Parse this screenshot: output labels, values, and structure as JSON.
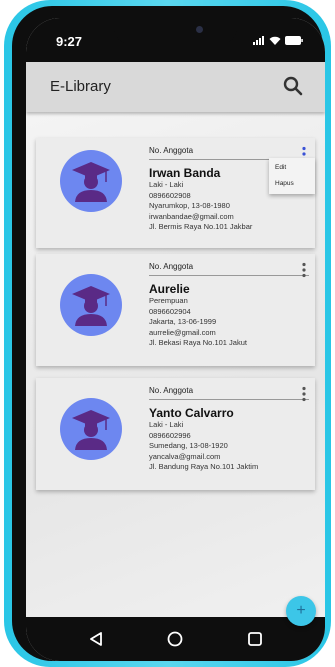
{
  "status": {
    "time": "9:27"
  },
  "appbar": {
    "title": "E-Library"
  },
  "members": [
    {
      "no_label": "No. Anggota",
      "name": "Irwan Banda",
      "gender": "Laki - Laki",
      "phone": "0896602908",
      "birth": "Nyarumkop, 13-08-1980",
      "email": "irwanbandae@gmail.com",
      "address": "Jl. Bermis Raya No.101 Jakbar"
    },
    {
      "no_label": "No. Anggota",
      "name": "Aurelie",
      "gender": "Perempuan",
      "phone": "0896602904",
      "birth": "Jakarta, 13-06-1999",
      "email": "aurrelie@gmail.com",
      "address": "Jl. Bekasi Raya No.101 Jakut"
    },
    {
      "no_label": "No. Anggota",
      "name": "Yanto Calvarro",
      "gender": "Laki - Laki",
      "phone": "0896602996",
      "birth": "Sumedang, 13-08-1920",
      "email": "yancalva@gmail.com",
      "address": "Jl. Bandung Raya No.101 Jaktim"
    }
  ],
  "menu": {
    "edit": "Edit",
    "delete": "Hapus"
  },
  "fab": {
    "icon": "+"
  },
  "icons": {
    "search": "search-icon",
    "more": "more-vertical-icon",
    "avatar": "graduate-icon",
    "back": "back-triangle-icon",
    "home": "home-circle-icon",
    "recents": "recents-square-icon"
  },
  "colors": {
    "frame": "#29c6e6",
    "appbar": "#d9d9d9",
    "avatar": "#6d87f0",
    "kebab_active": "#3a52d6",
    "fab": "#3cc6e8"
  }
}
